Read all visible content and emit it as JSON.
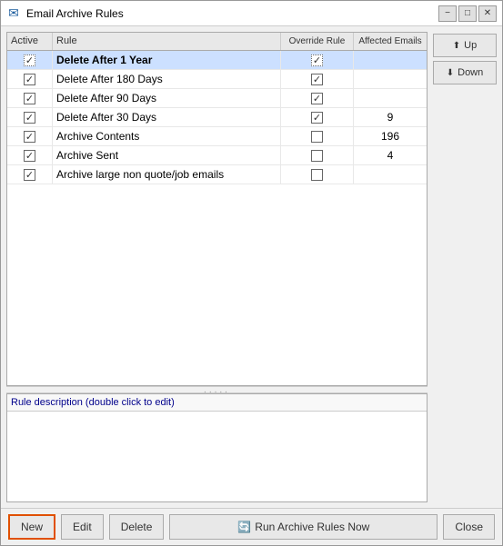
{
  "window": {
    "title": "Email Archive Rules",
    "icon": "✉"
  },
  "titlebar": {
    "minimize": "−",
    "maximize": "□",
    "close": "✕"
  },
  "table": {
    "headers": {
      "active": "Active",
      "rule": "Rule",
      "override_rule": "Override Rule",
      "affected_emails": "Affected Emails"
    },
    "rows": [
      {
        "active": true,
        "rule": "Delete After 1 Year",
        "override": true,
        "affected": "",
        "selected": true
      },
      {
        "active": true,
        "rule": "Delete After 180 Days",
        "override": true,
        "affected": "",
        "selected": false
      },
      {
        "active": true,
        "rule": "Delete After 90 Days",
        "override": true,
        "affected": "",
        "selected": false
      },
      {
        "active": true,
        "rule": "Delete After 30 Days",
        "override": true,
        "affected": "9",
        "selected": false
      },
      {
        "active": true,
        "rule": "Archive Contents",
        "override": false,
        "affected": "196",
        "selected": false
      },
      {
        "active": true,
        "rule": "Archive Sent",
        "override": false,
        "affected": "4",
        "selected": false
      },
      {
        "active": true,
        "rule": "Archive large non quote/job emails",
        "override": false,
        "affected": "",
        "selected": false
      }
    ]
  },
  "splitter_dots": ".....",
  "description": {
    "label": "Rule description (double click to edit)",
    "content": ""
  },
  "side_buttons": {
    "up": "Up",
    "down": "Down"
  },
  "footer_buttons": {
    "new": "New",
    "edit": "Edit",
    "delete": "Delete",
    "run": "Run Archive Rules Now",
    "close": "Close"
  }
}
